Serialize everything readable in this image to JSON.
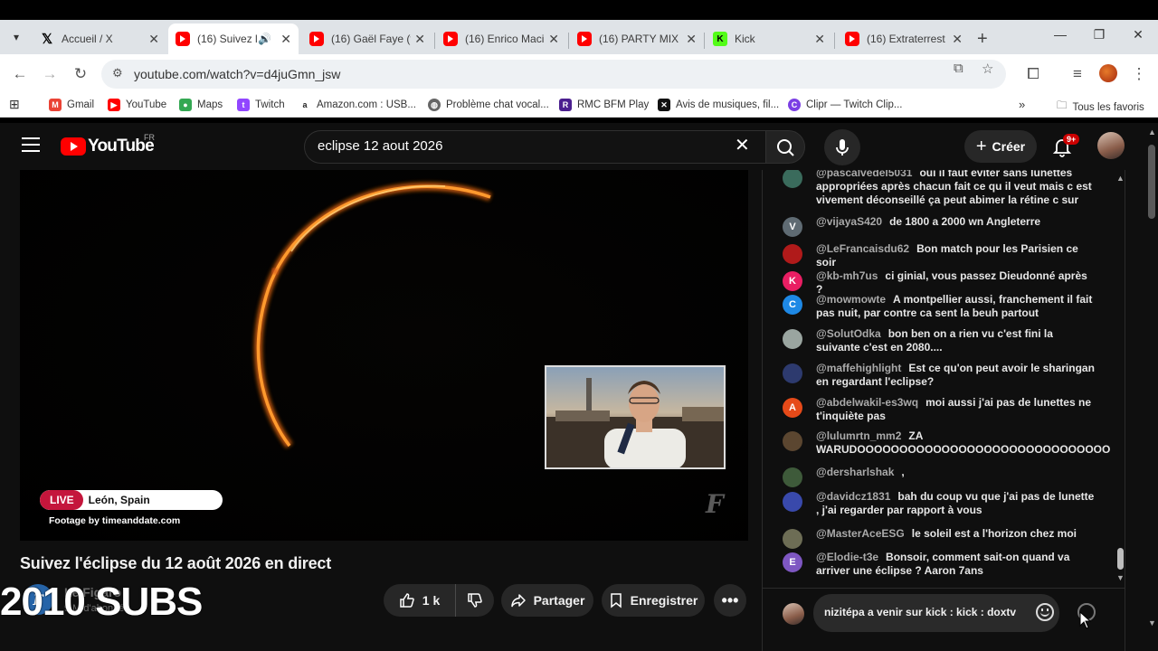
{
  "browser": {
    "tabs": [
      {
        "label": "Accueil / X",
        "favicon": "x-logo-icon",
        "active": false
      },
      {
        "label": "(16) Suivez l",
        "favicon": "youtube-icon",
        "active": true,
        "audio": true
      },
      {
        "label": "(16) Gaël Faye (f",
        "favicon": "youtube-icon",
        "active": false
      },
      {
        "label": "(16) Enrico Maci",
        "favicon": "youtube-icon",
        "active": false
      },
      {
        "label": "(16) PARTY MIX",
        "favicon": "youtube-icon",
        "active": false
      },
      {
        "label": "Kick",
        "favicon": "kick-icon",
        "active": false
      },
      {
        "label": "(16) Extraterrest",
        "favicon": "youtube-icon",
        "active": false
      }
    ],
    "url": "youtube.com/watch?v=d4juGmn_jsw",
    "bookmarks": [
      {
        "label": "Gmail",
        "color": "#ea4335"
      },
      {
        "label": "YouTube",
        "color": "#ff0000"
      },
      {
        "label": "Maps",
        "color": "#34a853"
      },
      {
        "label": "Twitch",
        "color": "#9146ff"
      },
      {
        "label": "Amazon.com : USB...",
        "color": "#222222"
      },
      {
        "label": "Problème chat vocal...",
        "color": "#555555"
      },
      {
        "label": "RMC BFM Play",
        "color": "#4b1f8f"
      },
      {
        "label": "Avis de musiques, fil...",
        "color": "#111111"
      },
      {
        "label": "Clipr — Twitch Clip...",
        "color": "#7b3fe4"
      }
    ],
    "all_bookmarks_label": "Tous les favoris"
  },
  "youtube": {
    "country_code": "FR",
    "search_query": "eclipse 12 aout 2026",
    "create_label": "Créer",
    "notification_badge": "9+",
    "video": {
      "live_label": "LIVE",
      "location": "León, Spain",
      "footage_credit": "Footage by timeanddate.com"
    },
    "title": "Suivez l'éclipse du 12 août 2026 en direct",
    "channel_name": "Le Figaro",
    "channel_subs": "9 M d'abonnés",
    "subs_overlay": "2010 SUBS",
    "like_count": "1 k",
    "share_label": "Partager",
    "save_label": "Enregistrer"
  },
  "chat": {
    "messages": [
      {
        "author": "@pascalvedel5031",
        "text": "oui il faut éviter sans lunettes appropriées après chacun fait ce qu il veut mais c est vivement déconseillé ça peut abimer la rétine c sur",
        "avatar_color": "#3a6b5c",
        "initial": ""
      },
      {
        "author": "@vijayaS420",
        "text": "de 1800 a 2000 wn Angleterre",
        "avatar_color": "#5f6b73",
        "initial": "V"
      },
      {
        "author": "@LeFrancaisdu62",
        "text": "Bon match pour les Parisien ce soir",
        "avatar_color": "#b01a1a",
        "initial": ""
      },
      {
        "author": "@kb-mh7us",
        "text": "ci ginial, vous passez Dieudonné après ?",
        "avatar_color": "#e91e63",
        "initial": "K"
      },
      {
        "author": "@mowmowte",
        "text": "A montpellier aussi, franchement il fait pas nuit, par contre ca sent la beuh partout",
        "avatar_color": "#1e88e5",
        "initial": "C"
      },
      {
        "author": "@SolutOdka",
        "text": "bon ben on a rien vu c'est fini la suivante c'est en 2080....",
        "avatar_color": "#9aa5a0",
        "initial": ""
      },
      {
        "author": "@maffehighlight",
        "text": "Est ce qu'on peut avoir le sharingan en regardant l'eclipse?",
        "avatar_color": "#2d3a6e",
        "initial": ""
      },
      {
        "author": "@abdelwakil-es3wq",
        "text": "moi aussi j'ai pas de lunettes ne t'inquiète pas",
        "avatar_color": "#e64a19",
        "initial": "A"
      },
      {
        "author": "@lulumrtn_mm2",
        "text": "ZA WARUDOOOOOOOOOOOOOOOOOOOOOOOOOOOOOO",
        "avatar_color": "#5b4630",
        "initial": ""
      },
      {
        "author": "@dersharlshak",
        "text": ",",
        "avatar_color": "#3e5a3a",
        "initial": ""
      },
      {
        "author": "@davidcz1831",
        "text": "bah du coup vu que j'ai pas de lunette , j'ai regarder par rapport à vous",
        "avatar_color": "#3949ab",
        "initial": ""
      },
      {
        "author": "@MasterAceESG",
        "text": "le soleil est a l'horizon chez moi",
        "avatar_color": "#6d6d55",
        "initial": ""
      },
      {
        "author": "@Elodie-t3e",
        "text": "Bonsoir, comment sait-on quand va arriver une éclipse ? Aaron 7ans",
        "avatar_color": "#7e57c2",
        "initial": "E"
      }
    ],
    "input_text": "nizitépa a venir sur kick : kick : doxtv"
  }
}
